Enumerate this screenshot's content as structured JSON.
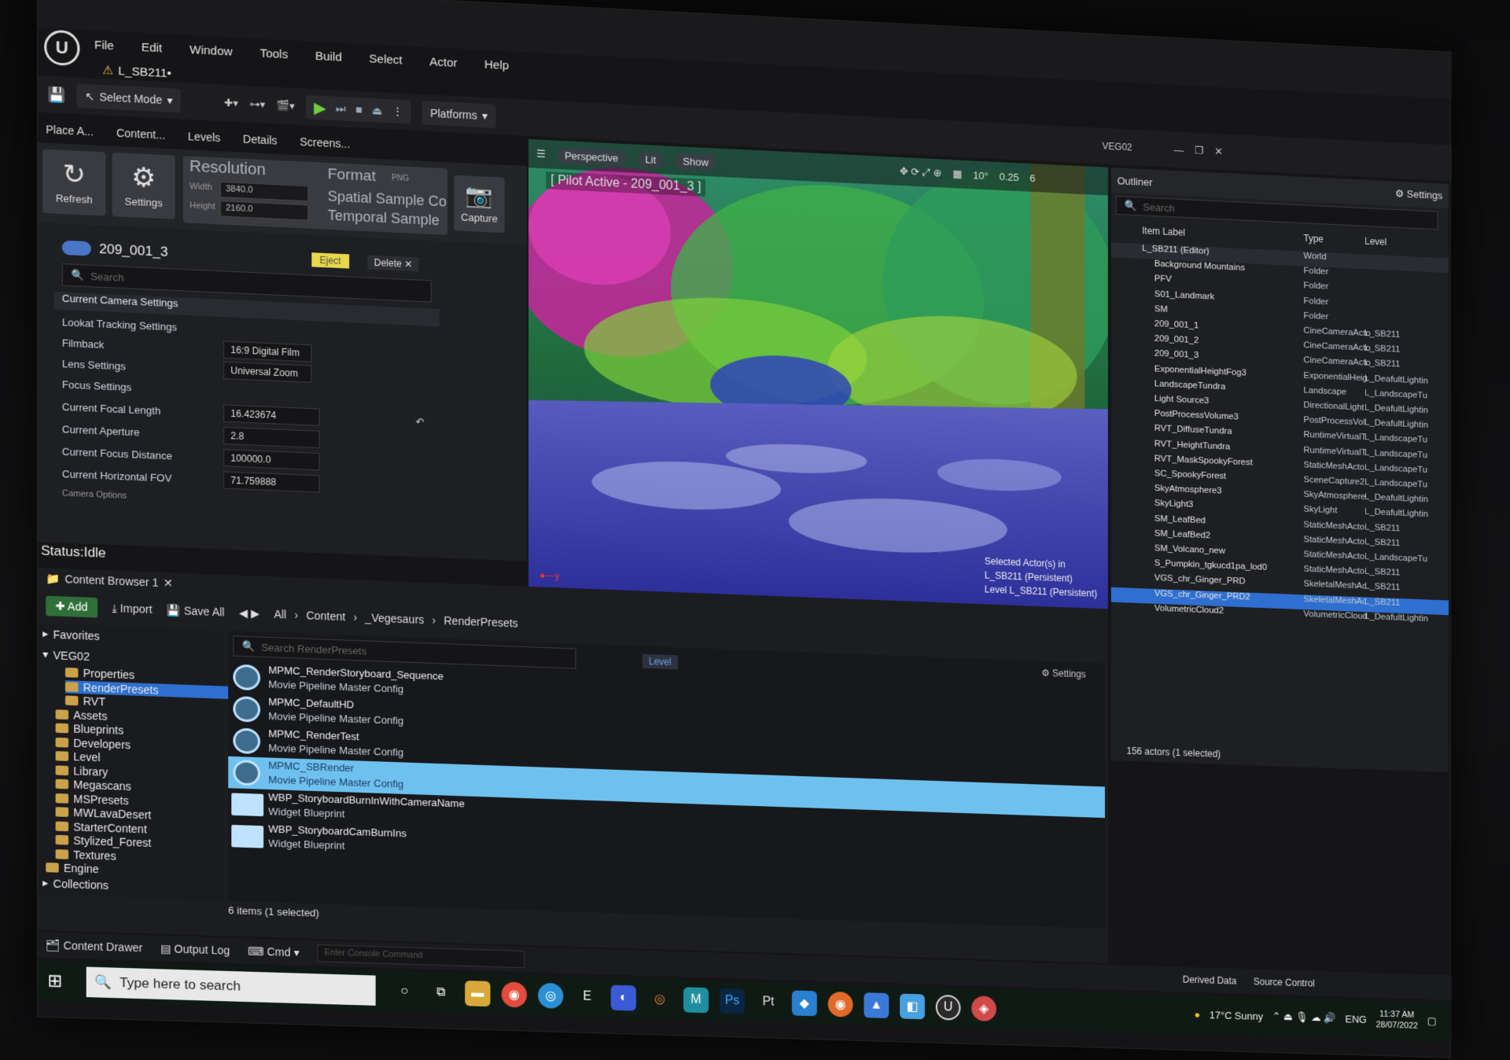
{
  "menu": {
    "items": [
      "File",
      "Edit",
      "Window",
      "Tools",
      "Build",
      "Select",
      "Actor",
      "Help"
    ],
    "level_tab": "L_SB211•"
  },
  "toolbar": {
    "select_mode": "Select Mode",
    "platforms": "Platforms",
    "project": "VEG02"
  },
  "left_tabs": {
    "place": "Place A...",
    "content": "Content...",
    "levels": "Levels",
    "details": "Details",
    "screens": "Screens..."
  },
  "mrq": {
    "refresh": "Refresh",
    "settings": "Settings",
    "resolution": "Resolution",
    "width_label": "Width",
    "width": "3840.0",
    "height_label": "Height",
    "height": "2160.0",
    "format": "Format",
    "format_val": "PNG",
    "spatial": "Spatial Sample Co",
    "temporal": "Temporal Sample",
    "capture": "Capture"
  },
  "camera": {
    "name": "209_001_3",
    "eject": "Eject",
    "delete": "Delete",
    "search_placeholder": "Search",
    "current_camera_settings": "Current Camera Settings",
    "lookat": "Lookat Tracking Settings",
    "filmback": "Filmback",
    "filmback_val": "16:9 Digital Film",
    "lens": "Lens Settings",
    "lens_val": "Universal Zoom",
    "focus": "Focus Settings",
    "focal_length": "Current Focal Length",
    "focal_length_val": "16.423674",
    "aperture": "Current Aperture",
    "aperture_val": "2.8",
    "focus_distance": "Current Focus Distance",
    "focus_distance_val": "100000.0",
    "fov": "Current Horizontal FOV",
    "fov_val": "71.759888",
    "camera_options": "Camera Options"
  },
  "status": "Status:Idle",
  "viewport": {
    "perspective": "Perspective",
    "lit": "Lit",
    "show": "Show",
    "pilot": "[ Pilot Active - 209_001_3 ]",
    "angle": "10°",
    "scale": "0.25",
    "speed": "6",
    "selected_actor": "Selected Actor(s) in",
    "persistent": "L_SB211 (Persistent)",
    "level": "Level L_SB211 (Persistent)"
  },
  "outliner": {
    "title": "Outliner",
    "settings": "Settings",
    "search_placeholder": "Search",
    "col_label": "Item Label",
    "col_type": "Type",
    "col_level": "Level",
    "rows": [
      {
        "name": "L_SB211 (Editor)",
        "type": "World",
        "level": ""
      },
      {
        "name": "Background Mountains",
        "type": "Folder",
        "level": ""
      },
      {
        "name": "PFV",
        "type": "Folder",
        "level": ""
      },
      {
        "name": "S01_Landmark",
        "type": "Folder",
        "level": ""
      },
      {
        "name": "SM",
        "type": "Folder",
        "level": ""
      },
      {
        "name": "209_001_1",
        "type": "CineCameraActo",
        "level": "L_SB211"
      },
      {
        "name": "209_001_2",
        "type": "CineCameraActo",
        "level": "L_SB211"
      },
      {
        "name": "209_001_3",
        "type": "CineCameraActo",
        "level": "L_SB211"
      },
      {
        "name": "ExponentialHeightFog3",
        "type": "ExponentialHeig",
        "level": "L_DeafultLightin"
      },
      {
        "name": "LandscapeTundra",
        "type": "Landscape",
        "level": "L_LandscapeTu"
      },
      {
        "name": "Light Source3",
        "type": "DirectionalLight",
        "level": "L_DeafultLightin"
      },
      {
        "name": "PostProcessVolume3",
        "type": "PostProcessVol",
        "level": "L_DeafultLightin"
      },
      {
        "name": "RVT_DiffuseTundra",
        "type": "RuntimeVirtualT",
        "level": "L_LandscapeTu"
      },
      {
        "name": "RVT_HeightTundra",
        "type": "RuntimeVirtualT",
        "level": "L_LandscapeTu"
      },
      {
        "name": "RVT_MaskSpookyForest",
        "type": "StaticMeshActo",
        "level": "L_LandscapeTu"
      },
      {
        "name": "SC_SpookyForest",
        "type": "SceneCapture2I",
        "level": "L_LandscapeTu"
      },
      {
        "name": "SkyAtmosphere3",
        "type": "SkyAtmosphere",
        "level": "L_DeafultLightin"
      },
      {
        "name": "SkyLight3",
        "type": "SkyLight",
        "level": "L_DeafultLightin"
      },
      {
        "name": "SM_LeafBed",
        "type": "StaticMeshActo",
        "level": "L_SB211"
      },
      {
        "name": "SM_LeafBed2",
        "type": "StaticMeshActo",
        "level": "L_SB211"
      },
      {
        "name": "SM_Volcano_new",
        "type": "StaticMeshActo",
        "level": "L_LandscapeTu"
      },
      {
        "name": "S_Pumpkin_tgkucd1pa_lod0",
        "type": "StaticMeshActo",
        "level": "L_SB211"
      },
      {
        "name": "VGS_chr_Ginger_PRD",
        "type": "SkeletalMeshAc",
        "level": "L_SB211"
      },
      {
        "name": "VGS_chr_Ginger_PRD2",
        "type": "SkeletalMeshAc",
        "level": "L_SB211"
      },
      {
        "name": "VolumetricCloud2",
        "type": "VolumetricCloud",
        "level": "L_DeafultLightin"
      }
    ],
    "footer": "156 actors (1 selected)"
  },
  "content_browser": {
    "tab": "Content Browser 1",
    "add": "Add",
    "import": "Import",
    "save_all": "Save All",
    "breadcrumb": [
      "All",
      "Content",
      "_Vegesaurs",
      "RenderPresets"
    ],
    "favorites": "Favorites",
    "root": "VEG02",
    "tree": [
      "Properties",
      "RenderPresets",
      "RVT",
      "Assets",
      "Blueprints",
      "Developers",
      "Level",
      "Library",
      "Megascans",
      "MSPresets",
      "MWLavaDesert",
      "StarterContent",
      "Stylized_Forest",
      "Textures",
      "Engine"
    ],
    "collections": "Collections",
    "search_placeholder": "Search RenderPresets",
    "settings": "Settings",
    "level_chip": "Level",
    "assets": [
      {
        "name": "MPMC_RenderStoryboard_Sequence",
        "type": "Movie Pipeline Master Config"
      },
      {
        "name": "MPMC_DefaultHD",
        "type": "Movie Pipeline Master Config"
      },
      {
        "name": "MPMC_RenderTest",
        "type": "Movie Pipeline Master Config"
      },
      {
        "name": "MPMC_SBRender",
        "type": "Movie Pipeline Master Config"
      },
      {
        "name": "WBP_StoryboardBurnInWithCameraName",
        "type": "Widget Blueprint"
      },
      {
        "name": "WBP_StoryboardCamBurnIns",
        "type": "Widget Blueprint"
      }
    ],
    "footer": "6 items (1 selected)"
  },
  "drawer": {
    "content_drawer": "Content Drawer",
    "output_log": "Output Log",
    "cmd": "Cmd",
    "console_placeholder": "Enter Console Command",
    "derived_data": "Derived Data",
    "source_control": "Source Control"
  },
  "taskbar": {
    "search": "Type here to search",
    "weather": "17°C Sunny",
    "lang": "ENG",
    "time": "11:37 AM",
    "date": "28/07/2022"
  }
}
